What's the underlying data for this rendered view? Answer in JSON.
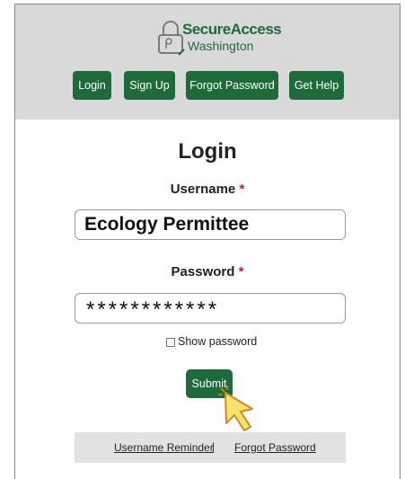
{
  "brand": {
    "title": "SecureAccess",
    "subtitle": "Washington",
    "color": "#1e6b3a"
  },
  "nav": {
    "items": [
      {
        "label": "Login"
      },
      {
        "label": "Sign Up"
      },
      {
        "label": "Forgot Password"
      },
      {
        "label": "Get Help"
      }
    ]
  },
  "form": {
    "title": "Login",
    "username_label": "Username",
    "username_value": "Ecology Permittee",
    "password_label": "Password",
    "password_mask": "************",
    "required_marker": "*",
    "show_password_label": "Show password",
    "submit_label": "Submit"
  },
  "footer": {
    "username_reminder": "Username Reminder",
    "separator": "|",
    "forgot_password": "Forgot Password"
  },
  "icons": {
    "logo": "padlock-icon",
    "cursor": "pointer-cursor-icon"
  }
}
